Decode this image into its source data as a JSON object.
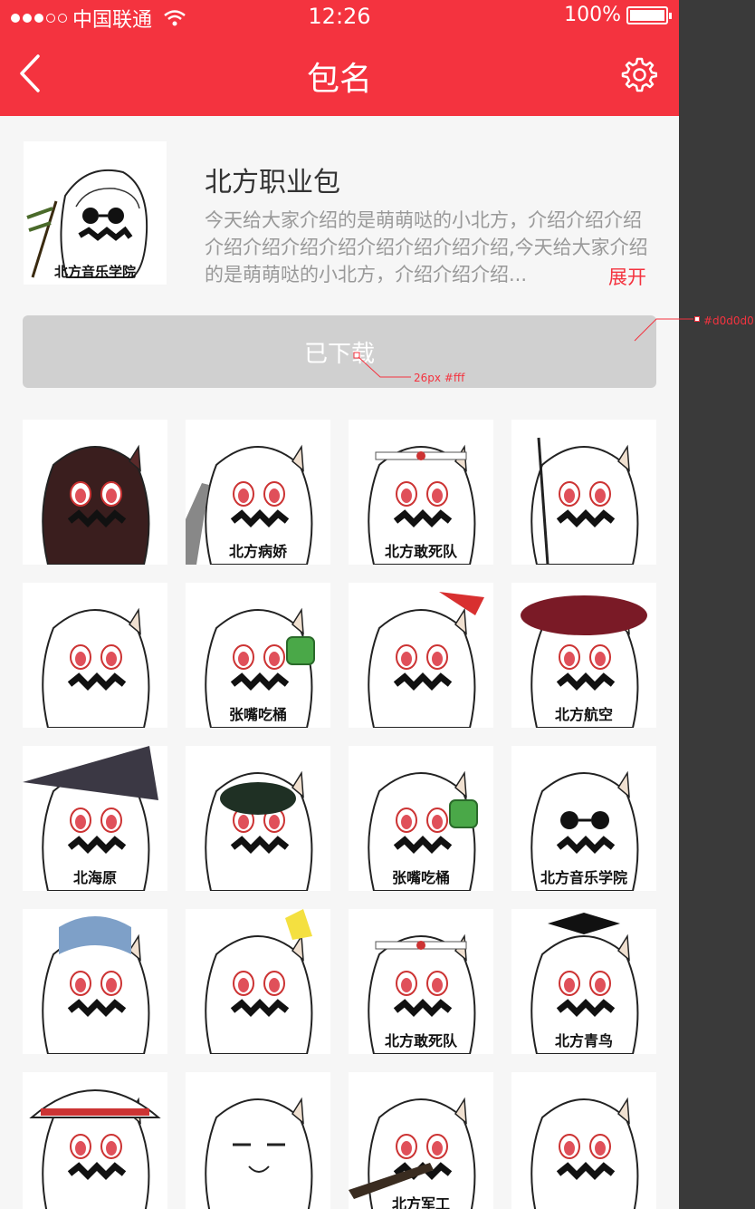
{
  "status": {
    "carrier": "中国联通",
    "time": "12:26",
    "battery": "100%"
  },
  "nav": {
    "title": "包名"
  },
  "pack": {
    "cover_caption": "北方音乐学院",
    "name": "北方职业包",
    "description": "今天给大家介绍的是萌萌哒的小北方，介绍介绍介绍介绍介绍介绍介绍介绍介绍介绍介绍,今天给大家介绍的是萌萌哒的小北方，介绍介绍介绍...",
    "expand_label": "展开"
  },
  "download_button": {
    "label": "已下载"
  },
  "annotations": {
    "bg_color": "#d0d0d0",
    "text_spec": "26px #fff"
  },
  "stickers": [
    {
      "caption": ""
    },
    {
      "caption": "北方病娇"
    },
    {
      "caption": "北方敢死队"
    },
    {
      "caption": ""
    },
    {
      "caption": ""
    },
    {
      "caption": "张嘴吃桶"
    },
    {
      "caption": ""
    },
    {
      "caption": "北方航空"
    },
    {
      "caption": "北海原"
    },
    {
      "caption": ""
    },
    {
      "caption": "张嘴吃桶"
    },
    {
      "caption": "北方音乐学院"
    },
    {
      "caption": ""
    },
    {
      "caption": ""
    },
    {
      "caption": "北方敢死队"
    },
    {
      "caption": "北方青鸟"
    },
    {
      "caption": ""
    },
    {
      "caption": ""
    },
    {
      "caption": "北方军工"
    },
    {
      "caption": ""
    }
  ],
  "colors": {
    "accent": "#f4333f",
    "button_bg": "#d0d0d0"
  }
}
